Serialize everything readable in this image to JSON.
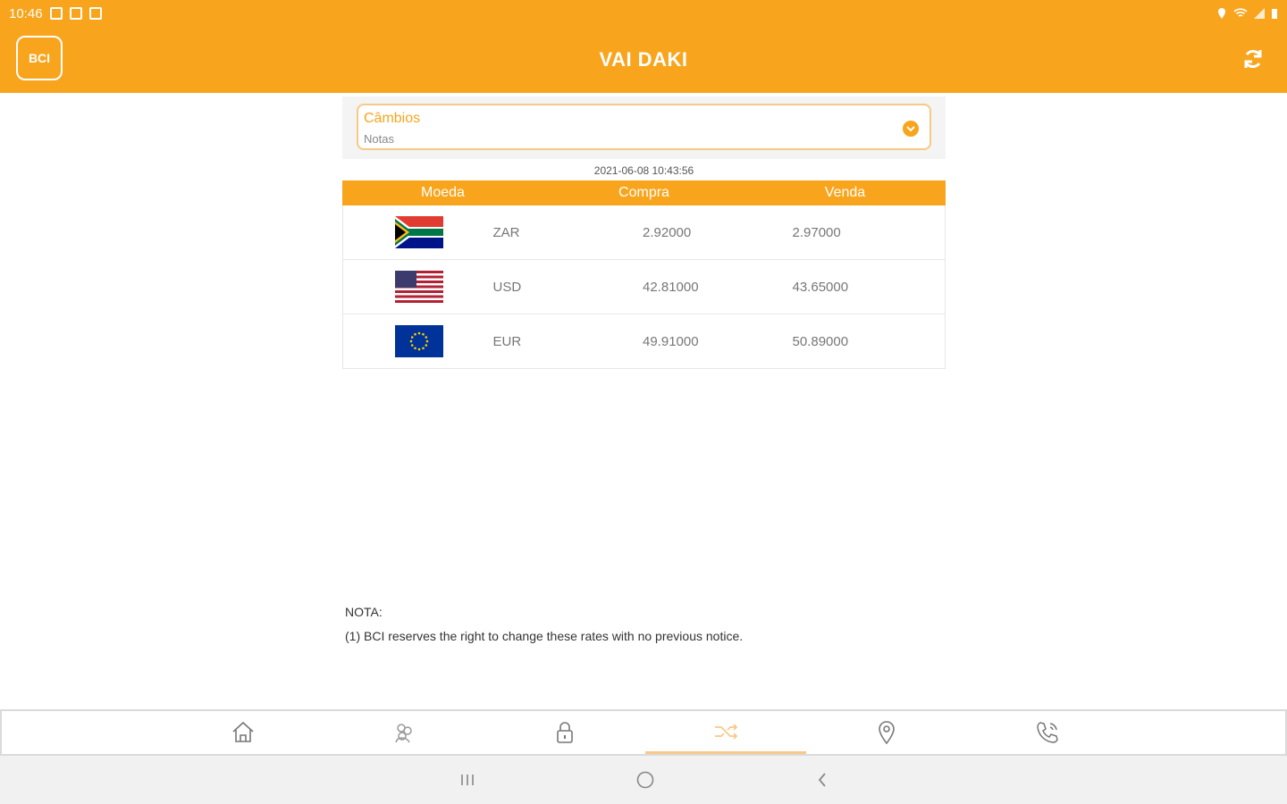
{
  "status_bar": {
    "time": "10:46"
  },
  "app_bar": {
    "title": "VAI DAKI",
    "logo_text": "BCI"
  },
  "selector": {
    "label": "Câmbios",
    "value": "Notas"
  },
  "timestamp": "2021-06-08 10:43:56",
  "table": {
    "headers": {
      "currency": "Moeda",
      "buy": "Compra",
      "sell": "Venda"
    },
    "rows": [
      {
        "code": "ZAR",
        "buy": "2.92000",
        "sell": "2.97000",
        "flag": "south-africa-flag"
      },
      {
        "code": "USD",
        "buy": "42.81000",
        "sell": "43.65000",
        "flag": "usa-flag"
      },
      {
        "code": "EUR",
        "buy": "49.91000",
        "sell": "50.89000",
        "flag": "eu-flag"
      }
    ]
  },
  "note": {
    "title": "NOTA:",
    "text": "(1) BCI reserves the right to change these rates with no previous notice."
  },
  "tabs": [
    {
      "icon": "home-icon"
    },
    {
      "icon": "people-icon"
    },
    {
      "icon": "lock-icon"
    },
    {
      "icon": "shuffle-icon",
      "active": true
    },
    {
      "icon": "location-pin-icon"
    },
    {
      "icon": "phone-icon"
    }
  ],
  "colors": {
    "accent": "#f8a51d",
    "accent_light": "#f6c986"
  }
}
